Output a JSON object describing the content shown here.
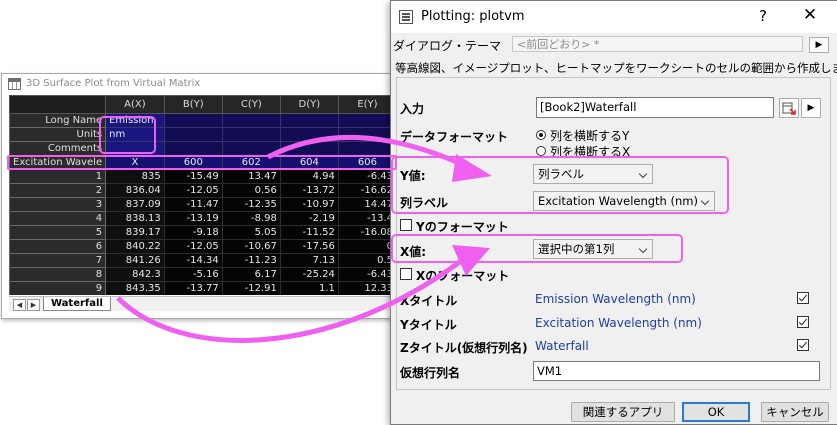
{
  "worksheet": {
    "title": "3D Surface Plot from Virtual Matrix",
    "columns": [
      "A(X)",
      "B(Y)",
      "C(Y)",
      "D(Y)",
      "E(Y)"
    ],
    "meta_rows": [
      {
        "label": "Long Name",
        "cells": [
          "Emission",
          "",
          "",
          "",
          ""
        ]
      },
      {
        "label": "Units",
        "cells": [
          "nm",
          "",
          "",
          "",
          ""
        ]
      },
      {
        "label": "Comments",
        "cells": [
          "",
          "",
          "",
          "",
          ""
        ]
      },
      {
        "label": "Excitation Wavele",
        "cells": [
          "X",
          "600",
          "602",
          "604",
          "606"
        ]
      }
    ],
    "data_rows": [
      {
        "n": "1",
        "cells": [
          "835",
          "-15.49",
          "13.47",
          "4.94",
          "-6.43"
        ]
      },
      {
        "n": "2",
        "cells": [
          "836.04",
          "-12.05",
          "0.56",
          "-13.72",
          "-16.62"
        ]
      },
      {
        "n": "3",
        "cells": [
          "837.09",
          "-11.47",
          "-12.35",
          "-10.97",
          "14.47"
        ]
      },
      {
        "n": "4",
        "cells": [
          "838.13",
          "-13.19",
          "-8.98",
          "-2.19",
          "-13.4"
        ]
      },
      {
        "n": "5",
        "cells": [
          "839.17",
          "-9.18",
          "5.05",
          "-11.52",
          "-16.08"
        ]
      },
      {
        "n": "6",
        "cells": [
          "840.22",
          "-12.05",
          "-10.67",
          "-17.56",
          "0"
        ]
      },
      {
        "n": "7",
        "cells": [
          "841.26",
          "-14.34",
          "-11.23",
          "7.13",
          "0.5"
        ]
      },
      {
        "n": "8",
        "cells": [
          "842.3",
          "-5.16",
          "6.17",
          "-25.24",
          "-6.43"
        ]
      },
      {
        "n": "9",
        "cells": [
          "843.35",
          "-13.77",
          "-12.91",
          "1.1",
          "12.33"
        ]
      }
    ],
    "sheet_tab": "Waterfall",
    "tab_prev": "◀",
    "tab_next": "▶"
  },
  "dialog": {
    "title": "Plotting: plotvm",
    "help": "?",
    "close": "✕",
    "theme_label": "ダイアログ・テーマ",
    "theme_value": "<前回どおり> *",
    "theme_next": "▶",
    "description": "等高線図、イメージプロット、ヒートマップをワークシートのセルの範囲から作成します",
    "input_label": "入力",
    "input_value": "[Book2]Waterfall",
    "input_next": "▶",
    "data_format_label": "データフォーマット",
    "data_format_opt1": "列を横断するY",
    "data_format_opt2": "列を横断するX",
    "y_value_label": "Y値:",
    "y_value": "列ラベル",
    "col_label_label": "列ラベル",
    "col_label_value": "Excitation Wavelength (nm)",
    "y_format_label": "Yのフォーマット",
    "x_value_label": "X値:",
    "x_value": "選択中の第1列",
    "x_format_label": "Xのフォーマット",
    "x_title_label": "Xタイトル",
    "x_title_value": "Emission Wavelength (nm)",
    "y_title_label": "Yタイトル",
    "y_title_value": "Excitation Wavelength (nm)",
    "z_title_label": "Zタイトル(仮想行列名)",
    "z_title_value": "Waterfall",
    "vm_name_label": "仮想行列名",
    "vm_name_value": "VM1",
    "btn_related": "関連するアプリ",
    "btn_ok": "OK",
    "btn_cancel": "キャンセル"
  },
  "colors": {
    "highlight": "#f060f0",
    "link_text": "#1f3ea0",
    "grid_meta": "#120c55"
  }
}
